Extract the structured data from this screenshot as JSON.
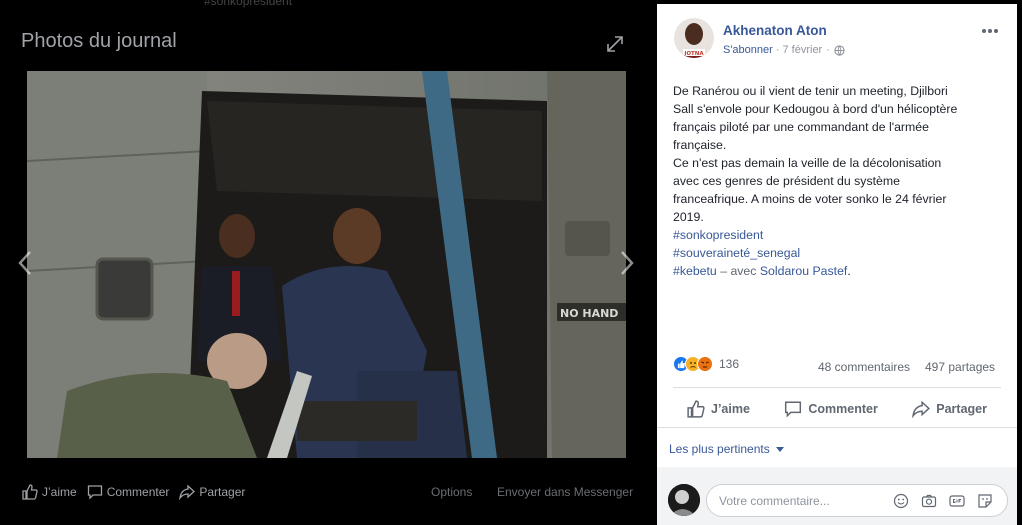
{
  "viewer": {
    "top_ghost_text": "#sonkopresident",
    "title": "Photos du journal",
    "actions": {
      "like": "J’aime",
      "comment": "Commenter",
      "share": "Partager"
    },
    "options": "Options",
    "send_messenger": "Envoyer dans Messenger",
    "photo_sign": "NO HAND"
  },
  "post": {
    "author": "Akhenaton Aton",
    "avatar_caption": "JOTNA",
    "follow": "S'abonner",
    "date": "7 février",
    "separator": "·",
    "text_lines": [
      "De Ranérou ou il vient de tenir un meeting, Djilbori",
      "Sall s'envole pour Kedougou à bord d'un hélicoptère",
      "français piloté par une commandant de l'armée",
      "française.",
      "Ce n'est pas demain la veille de la décolonisation",
      "avec ces genres de président du système",
      "franceafrique. A moins de voter sonko le 24 février",
      "2019."
    ],
    "hashtags": [
      "#sonkopresident",
      "#souveraineté_senegal",
      "#kebetu"
    ],
    "with_text": "– avec",
    "tagged": "Soldarou Pastef",
    "tail": ".",
    "reaction_count": "136",
    "comments": "48 commentaires",
    "shares": "497 partages",
    "actions": {
      "like": "J’aime",
      "comment": "Commenter",
      "share": "Partager"
    },
    "sort": "Les plus pertinents",
    "comment_placeholder": "Votre commentaire..."
  },
  "icons": {
    "expand": "expand-icon",
    "globe": "globe-icon",
    "more": "more-icon",
    "reactions": [
      "like-reaction-icon",
      "sad-reaction-icon",
      "angry-reaction-icon"
    ],
    "composer": [
      "emoji-icon",
      "camera-icon",
      "gif-icon",
      "sticker-icon"
    ]
  },
  "colors": {
    "link": "#385898",
    "like": "#1877f2",
    "sad": "#f7b125",
    "angry": "#e9710f",
    "viewer_bg": "#000000"
  }
}
